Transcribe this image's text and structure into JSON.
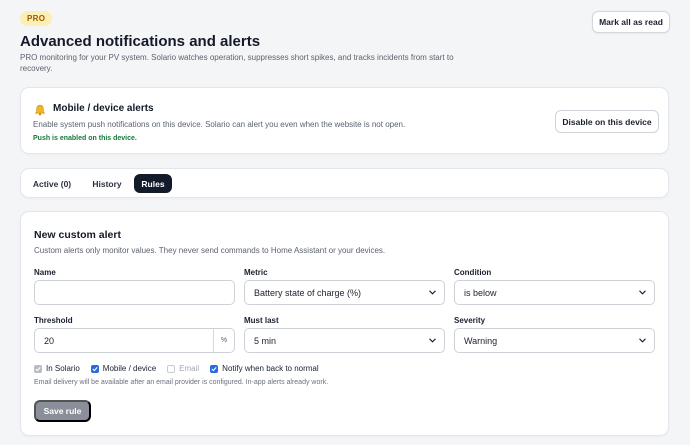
{
  "header": {
    "badge": "PRO",
    "title": "Advanced notifications and alerts",
    "subtitle": "PRO monitoring for your PV system. Solario watches operation, suppresses short spikes, and tracks incidents from start to recovery.",
    "mark_all_label": "Mark all as read"
  },
  "device_alerts": {
    "icon": "bell-icon",
    "title": "Mobile / device alerts",
    "description": "Enable system push notifications on this device. Solario can alert you even when the website is not open.",
    "status": "Push is enabled on this device.",
    "disable_label": "Disable on this device"
  },
  "tabs": [
    {
      "label": "Active (0)",
      "active": false
    },
    {
      "label": "History",
      "active": false
    },
    {
      "label": "Rules",
      "active": true
    }
  ],
  "form": {
    "title": "New custom alert",
    "description": "Custom alerts only monitor values. They never send commands to Home Assistant or your devices.",
    "name": {
      "label": "Name",
      "value": ""
    },
    "metric": {
      "label": "Metric",
      "value": "Battery state of charge (%)"
    },
    "condition": {
      "label": "Condition",
      "value": "is below"
    },
    "threshold": {
      "label": "Threshold",
      "value": "20",
      "unit": "%"
    },
    "must_last": {
      "label": "Must last",
      "value": "5 min"
    },
    "severity": {
      "label": "Severity",
      "value": "Warning"
    },
    "channels": [
      {
        "label": "In Solario",
        "checked": true,
        "disabled": true
      },
      {
        "label": "Mobile / device",
        "checked": true,
        "disabled": false
      },
      {
        "label": "Email",
        "checked": false,
        "disabled": true
      },
      {
        "label": "Notify when back to normal",
        "checked": true,
        "disabled": false
      }
    ],
    "email_note": "Email delivery will be available after an email provider is configured. In-app alerts already work.",
    "save_label": "Save rule"
  },
  "colors": {
    "accent_dark": "#131a2a",
    "checkbox_blue": "#2a6ae0",
    "success_green": "#137a3c",
    "pro_badge_bg": "#fcefb4"
  }
}
